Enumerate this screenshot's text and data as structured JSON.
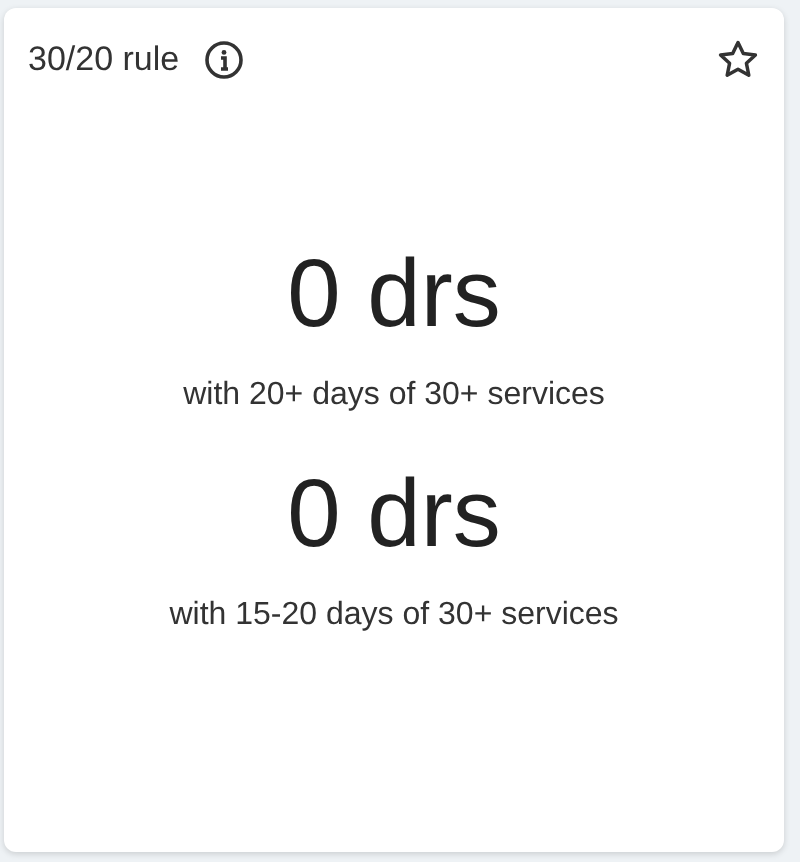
{
  "card": {
    "title": "30/20 rule",
    "favorite": false,
    "stats": [
      {
        "value": "0 drs",
        "caption": "with 20+ days of 30+ services"
      },
      {
        "value": "0 drs",
        "caption": "with 15-20 days of 30+ services"
      }
    ]
  }
}
